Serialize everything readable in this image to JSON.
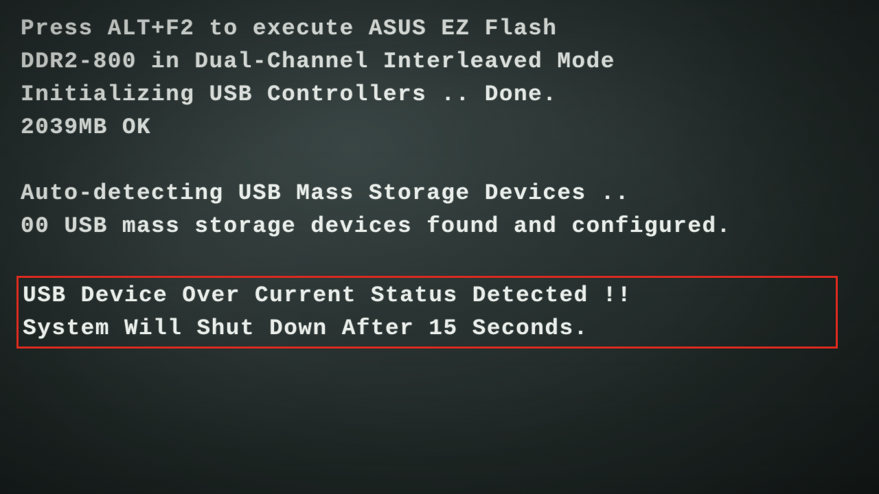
{
  "bios": {
    "line1": "Press ALT+F2 to execute ASUS EZ Flash",
    "line2": "DDR2-800 in Dual-Channel Interleaved Mode",
    "line3": "Initializing USB Controllers .. Done.",
    "line4": "2039MB OK",
    "line5": "Auto-detecting USB Mass Storage Devices ..",
    "line6": "00 USB mass storage devices found and configured.",
    "error1": "USB Device Over Current Status Detected !!",
    "error2": "System Will Shut Down After 15 Seconds."
  }
}
